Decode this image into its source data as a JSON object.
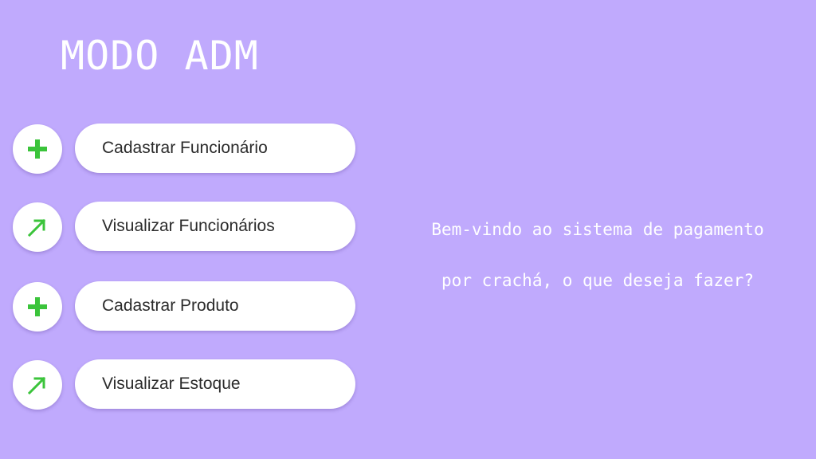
{
  "header": {
    "title": "MODO ADM"
  },
  "menu": {
    "items": [
      {
        "label": "Cadastrar Funcionário",
        "icon": "plus-icon"
      },
      {
        "label": "Visualizar Funcionários",
        "icon": "arrow-up-right-icon"
      },
      {
        "label": "Cadastrar Produto",
        "icon": "plus-icon"
      },
      {
        "label": "Visualizar Estoque",
        "icon": "arrow-up-right-icon"
      }
    ]
  },
  "welcome": {
    "line1": "Bem-vindo ao sistema de pagamento",
    "line2": "por crachá, o que deseja fazer?"
  },
  "colors": {
    "background": "#c0aafd",
    "card": "#ffffff",
    "icon_accent": "#3bc43b",
    "text_dark": "#2b2b2b",
    "text_light": "#ffffff"
  }
}
